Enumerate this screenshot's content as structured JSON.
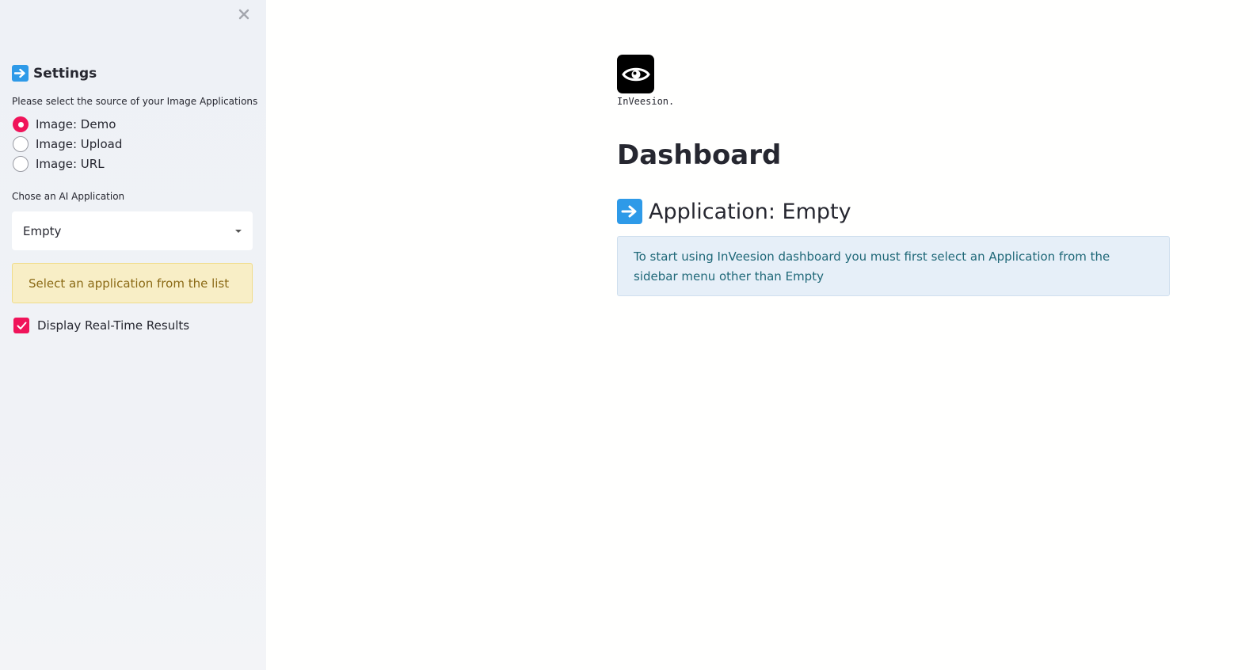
{
  "sidebar": {
    "close_icon": "close-icon",
    "heading_icon": "arrow-right-icon",
    "heading": "Settings",
    "source_label": "Please select the source of your Image Applications",
    "source_options": [
      "Image: Demo",
      "Image: Upload",
      "Image: URL"
    ],
    "source_selected": "Image: Demo",
    "app_label": "Chose an AI Application",
    "app_selected": "Empty",
    "warning": "Select an application from the list",
    "realtime_label": "Display Real-Time Results",
    "realtime_checked": true
  },
  "main": {
    "logo_icon": "eye-icon",
    "logo_caption": "InVeesion.",
    "title": "Dashboard",
    "app_heading_icon": "arrow-right-icon",
    "app_heading": "Application: Empty",
    "info": "To start using InVeesion dashboard you must first select an Application from the sidebar menu other than Empty"
  },
  "colors": {
    "accent": "#f0145a",
    "sidebar_bg": "#f0f2f6",
    "info_bg": "#e6eff8",
    "info_text": "#1f6878",
    "warning_bg": "#f8eec6",
    "warning_text": "#8b6a16",
    "emoji_blue": "#2e9ae8"
  }
}
